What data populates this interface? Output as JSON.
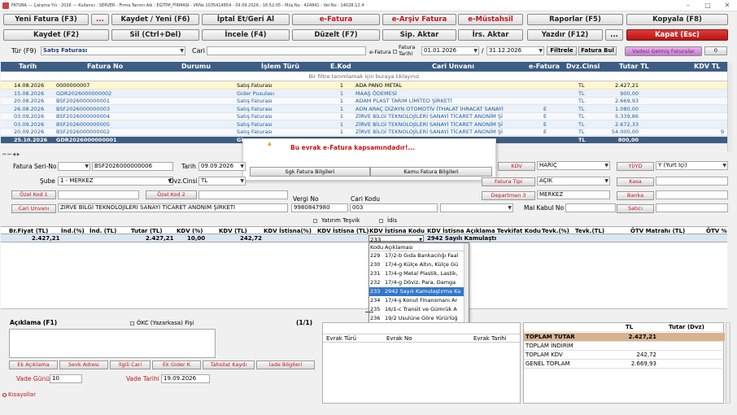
{
  "window": {
    "title": "FATURA  ---  Çalışma Yılı : 2026  ---  Kullanıcı : SERVER  -  Firma Tanımı Adı : EĞİTİM_FİRMASI  -  VKNo 1035414854  -  09.09.2026  :  16:52:05  -  Müş.No : 424841  -  Ver.No : 14028-12.4",
    "minimize": "–",
    "maximize": "□",
    "close": "✕"
  },
  "toolbar1": [
    "Yeni Fatura (F3)",
    "...",
    "Kaydet / Yeni (F6)",
    "İptal Et/Geri Al",
    "e-Fatura",
    "e-Arşiv Fatura",
    "e-Müstahsil",
    "Raporlar (F5)",
    "Kopyala (F8)"
  ],
  "toolbar2": [
    "Kaydet (F2)",
    "Sil (Ctrl+Del)",
    "İncele (F4)",
    "Düzelt (F7)",
    "Sip. Aktar",
    "İrs. Aktar",
    "Yazdır (F12)",
    "...",
    "Kapat (Esc)"
  ],
  "filter": {
    "tur_label": "Tür (F9)",
    "tur_value": "Satış Faturası",
    "cari_label": "Cari",
    "efatura_label": "e-Fatura",
    "fatura_tarihi_label1": "Fatura",
    "fatura_tarihi_label2": "Tarihi",
    "date_from": "01.01.2026",
    "slash": "/",
    "date_to": "31.12.2026",
    "filtrele": "Filtrele",
    "fatura_bul": "Fatura Bul",
    "vadesi": "Vadesi Gelmiş Faturalar",
    "extra": "0"
  },
  "grid": {
    "headers": [
      "Tarih",
      "Fatura No",
      "Durumu",
      "İşlem Türü",
      "E.Kod",
      "Cari Unvanı",
      "e-Fatura",
      "Dvz.Cinsi",
      "Tutar TL",
      "KDV TL"
    ],
    "filter_hint": "Bir filtre tanımlamak için buraya tıklayınız",
    "rows": [
      {
        "tarih": "14.08.2026",
        "no": "0000000007",
        "tur": "Satış Faturası",
        "ekod": "1",
        "cari": "ADA PANO METAL",
        "ef": "",
        "dvz": "TL",
        "tutar": "2.427,21",
        "kdv": "",
        "style": "sel"
      },
      {
        "tarih": "15.08.2026",
        "no": "GDR2026000000002",
        "tur": "Gider Pusulası",
        "ekod": "1",
        "cari": "MAAŞ ÖDEMESİ",
        "ef": "",
        "dvz": "TL",
        "tutar": "900,00",
        "kdv": "",
        "style": "blue"
      },
      {
        "tarih": "20.08.2026",
        "no": "BSF2026000000001",
        "tur": "Satış Faturası",
        "ekod": "1",
        "cari": "ADAM PLAST TARIM LİMİTED ŞİRKETİ",
        "ef": "",
        "dvz": "TL",
        "tutar": "2.669,93",
        "kdv": "",
        "style": "blue"
      },
      {
        "tarih": "26.08.2026",
        "no": "BSF2026000000003",
        "tur": "Satış Faturası",
        "ekod": "1",
        "cari": "ADN ARAÇ DİZAYN OTOMOTİV İTHALAT İHRACAT SANAYİ",
        "ef": "E",
        "dvz": "TL",
        "tutar": "1.080,00",
        "kdv": "",
        "style": "blue"
      },
      {
        "tarih": "03.09.2026",
        "no": "BSF2026000000004",
        "tur": "Satış Faturası",
        "ekod": "1",
        "cari": "ZİRVE BİLGİ TEKNOLOJİLERİ SANAYİ TİCARET ANONİM Şİ",
        "ef": "E",
        "dvz": "TL",
        "tutar": "5.339,86",
        "kdv": "",
        "style": "blue"
      },
      {
        "tarih": "03.09.2026",
        "no": "BSF2026000000005",
        "tur": "Satış Faturası",
        "ekod": "1",
        "cari": "ZİRVE BİLGİ TEKNOLOJİLERİ SANAYİ TİCARET ANONİM Şİ",
        "ef": "E",
        "dvz": "TL",
        "tutar": "2.672,33",
        "kdv": "",
        "style": "blue"
      },
      {
        "tarih": "20.09.2026",
        "no": "BSF2026000000002",
        "tur": "Satış Faturası",
        "ekod": "1",
        "cari": "ZİRVE BİLGİ TEKNOLOJİLERİ SANAYİ TİCARET ANONİM Şİ",
        "ef": "E",
        "dvz": "TL",
        "tutar": "54.000,00",
        "kdv": "9",
        "style": "blue"
      },
      {
        "tarih": "25.10.2026",
        "no": "GDR2026000000001",
        "tur": "Gi",
        "ekod": "",
        "cari": "",
        "ef": "",
        "dvz": "TL",
        "tutar": "800,00",
        "kdv": "",
        "style": "last"
      }
    ]
  },
  "popup": {
    "message": "Bu evrak e-Fatura kapsamındadır!...",
    "sgk": "Sgk Fatura Bilgileri",
    "kamu": "Kamu Fatura Bilgileri",
    "warn": "▲"
  },
  "form": {
    "seri_label": "Fatura Seri-No",
    "seri_value": "BSF2026000000006",
    "tarih_label": "Tarih",
    "tarih_value": "09.09.2026",
    "sube_label": "Şube",
    "sube_value": "1 - MERKEZ",
    "dvz_label": "Dvz.Cinsi",
    "dvz_value": "TL",
    "ozel1": "Özel Kod 1",
    "ozel2": "Özel Kod 2",
    "vergi_label": "Vergi No",
    "vergi_value": "9980847980",
    "cari_kodu_label": "Cari Kodu",
    "cari_kodu_value": "003",
    "cari_unvani_btn": "Cari Unvanı",
    "cari_unvani_value": "ZİRVE BİLGİ TEKNOLOJİLERİ SANAYİ TİCARET ANONİM ŞİRKETİ",
    "mal_kabul": "Mal Kabul No",
    "kdv_btn": "KDV",
    "kdv_value": "HARİÇ",
    "yiyd_btn": "Yİ/YD",
    "yiyd_value": "Y (Yurt İçi)",
    "fatura_tipi_btn": "Fatura Tipi",
    "fatura_tipi_value": "AÇIK",
    "kasa_btn": "Kasa",
    "departman_btn": "Departman 3",
    "departman_value": "MERKEZ",
    "banka_btn": "Banka",
    "satici_btn": "Satıcı",
    "yatirim": "Yatırım Teşvik",
    "idis": "İdis"
  },
  "lines": {
    "headers": [
      "Br.Fiyat (TL)",
      "İnd.(%)",
      "İnd. (TL)",
      "Tutar (TL)",
      "KDV (%)",
      "KDV (TL)",
      "KDV İstisna(%)",
      "KDV İstisna (TL)",
      "KDV İstisna Kodu",
      "KDV İstisna Açıklama",
      "Tevkifat Kodu",
      "Tevk.(%)",
      "Tevk.(TL)",
      "ÖTV Matrahı (TL)",
      "ÖTV %"
    ],
    "row": {
      "brfiyat": "2.427,21",
      "tutar": "2.427,21",
      "kdv_oran": "10,00",
      "kdv_tl": "242,72",
      "istisna_kodu": "233",
      "istisna_aciklama": "2942 Sayılı Kamulaştı"
    }
  },
  "kodlist": {
    "h1": "Kodu",
    "h2": "Açıklaması",
    "items": [
      {
        "c": "229",
        "a": "17/2-b Gıda Bankacılığı Faal"
      },
      {
        "c": "230",
        "a": "17/4-g Külçe Altın, Külçe Gü"
      },
      {
        "c": "231",
        "a": "17/4-g Metal Plastik, Lastik,"
      },
      {
        "c": "232",
        "a": "17/4-g Döviz, Para, Damga"
      },
      {
        "c": "233",
        "a": "2942 Sayılı Kamulaştırma Ka"
      },
      {
        "c": "234",
        "a": "17/4-ş Konut Finansmanı Ar"
      },
      {
        "c": "235",
        "a": "16/1-c Transit ve Gümrük A"
      },
      {
        "c": "236",
        "a": "19/2 Usulüne Göre Yürürlüğ"
      }
    ]
  },
  "bottom": {
    "aciklama": "Açıklama (F1)",
    "okc": "ÖKC (Yazarkasa) Fişi",
    "page": "(1/1)",
    "buttons": [
      "Ek Açıklama",
      "Sevk Adresi",
      "İlgili Cari",
      "Ek Gider K",
      "Tahsilat Kaydı",
      "İade Bilgileri"
    ],
    "vade_gunu_label": "Vade Günü",
    "vade_gunu_value": "10",
    "vade_tarihi_label": "Vade Tarihi",
    "vade_tarihi_value": "19.09.2026",
    "kisayollar": "Kısayollar",
    "evrak_headers": [
      "Evrak Türü",
      "Evrak No",
      "Evrak Tarihi"
    ]
  },
  "totals": {
    "col_tl": "TL",
    "col_dvz": "Tutar (Dvz)",
    "rows": [
      {
        "label": "TOPLAM TUTAR",
        "value": "2.427,21"
      },
      {
        "label": "TOPLAM İNDİRİM",
        "value": ""
      },
      {
        "label": "TOPLAM KDV",
        "value": "242,72"
      },
      {
        "label": "GENEL TOPLAM",
        "value": "2.669,93"
      }
    ]
  },
  "colors": {
    "header_blue": "#3d5d83",
    "selected_row": "#fff7cc",
    "red_button": "#c0151a",
    "list_select": "#3378c8",
    "totals_header": "#d7b28f"
  }
}
